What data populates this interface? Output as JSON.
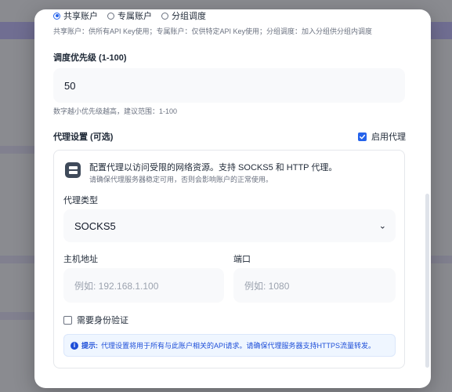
{
  "account_type": {
    "options": [
      {
        "label": "共享账户",
        "checked": true
      },
      {
        "label": "专属账户",
        "checked": false
      },
      {
        "label": "分组调度",
        "checked": false
      }
    ],
    "hint": "共享账户：供所有API Key使用；专属账户：仅供特定API Key使用；分组调度：加入分组供分组内调度"
  },
  "priority": {
    "label": "调度优先级 (1-100)",
    "value": "50",
    "hint": "数字越小优先级越高，建议范围：1-100"
  },
  "proxy": {
    "label": "代理设置 (可选)",
    "enable_label": "启用代理",
    "enabled": true,
    "icon": "server-icon",
    "description": "配置代理以访问受限的网络资源。支持 SOCKS5 和 HTTP 代理。",
    "description_sub": "请确保代理服务器稳定可用，否则会影响账户的正常使用。",
    "type_label": "代理类型",
    "type_value": "SOCKS5",
    "host_label": "主机地址",
    "host_placeholder": "例如: 192.168.1.100",
    "port_label": "端口",
    "port_placeholder": "例如: 1080",
    "auth_label": "需要身份验证",
    "auth_checked": false,
    "tip_title": "提示:",
    "tip_text": "代理设置将用于所有与此账户相关的API请求。请确保代理服务器支持HTTPS流量转发。"
  },
  "colors": {
    "accent": "#2563eb",
    "tip_text": "#1d4ed8",
    "tip_bg": "#eff6ff"
  }
}
